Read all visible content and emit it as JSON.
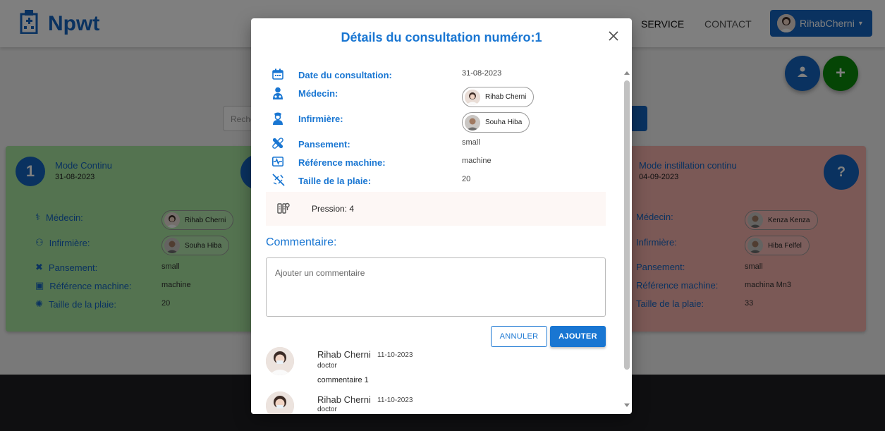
{
  "navbar": {
    "brand": "Npwt",
    "links": [
      "SERVICE",
      "CONTACT"
    ],
    "user": "RihabCherni"
  },
  "background": {
    "search_placeholder": "Reche",
    "card_left": {
      "number": "1",
      "title": "Mode Continu",
      "date": "31-08-2023",
      "medecin_label": "Médecin:",
      "medecin": "Rihab Cherni",
      "infirmiere_label": "Infirmière:",
      "infirmiere": "Souha Hiba",
      "pansement_label": "Pansement:",
      "pansement": "small",
      "reference_label": "Référence machine:",
      "reference": "machine",
      "taille_label": "Taille de la plaie:",
      "taille": "20"
    },
    "card_right": {
      "title": "Mode instillation continu",
      "date": "04-09-2023",
      "help": "?",
      "medecin_label": "Médecin:",
      "medecin": "Kenza Kenza",
      "infirmiere_label": "Infirmière:",
      "infirmiere": "Hiba Felfel",
      "pansement_label": "Pansement:",
      "pansement": "small",
      "reference_label": "Référence machine:",
      "reference": "machina Mn3",
      "taille_label": "Taille de la plaie:",
      "taille": "33"
    }
  },
  "modal": {
    "title": "Détails du consultation numéro:1",
    "details": {
      "date_label": "Date du consultation:",
      "date": "31-08-2023",
      "medecin_label": "Médecin:",
      "medecin": "Rihab Cherni",
      "infirmiere_label": "Infirmière:",
      "infirmiere": "Souha Hiba",
      "pansement_label": "Pansement:",
      "pansement": "small",
      "reference_label": "Référence machine:",
      "reference": "machine",
      "taille_label": "Taille de la plaie:",
      "taille": "20"
    },
    "pression": "Pression: 4",
    "comment_title": "Commentaire:",
    "comment_placeholder": "Ajouter un commentaire",
    "cancel_label": "ANNULER",
    "add_label": "AJOUTER",
    "comments": [
      {
        "name": "Rihab Cherni",
        "date": "11-10-2023",
        "role": "doctor",
        "text": "commentaire 1"
      },
      {
        "name": "Rihab Cherni",
        "date": "11-10-2023",
        "role": "doctor",
        "text": ""
      }
    ]
  },
  "colors": {
    "primary": "#1976d2",
    "card_green": "#a9e6a1",
    "card_red": "#f7b2ac",
    "fab_green": "#0a8a0a",
    "footer": "#1e1f22"
  }
}
